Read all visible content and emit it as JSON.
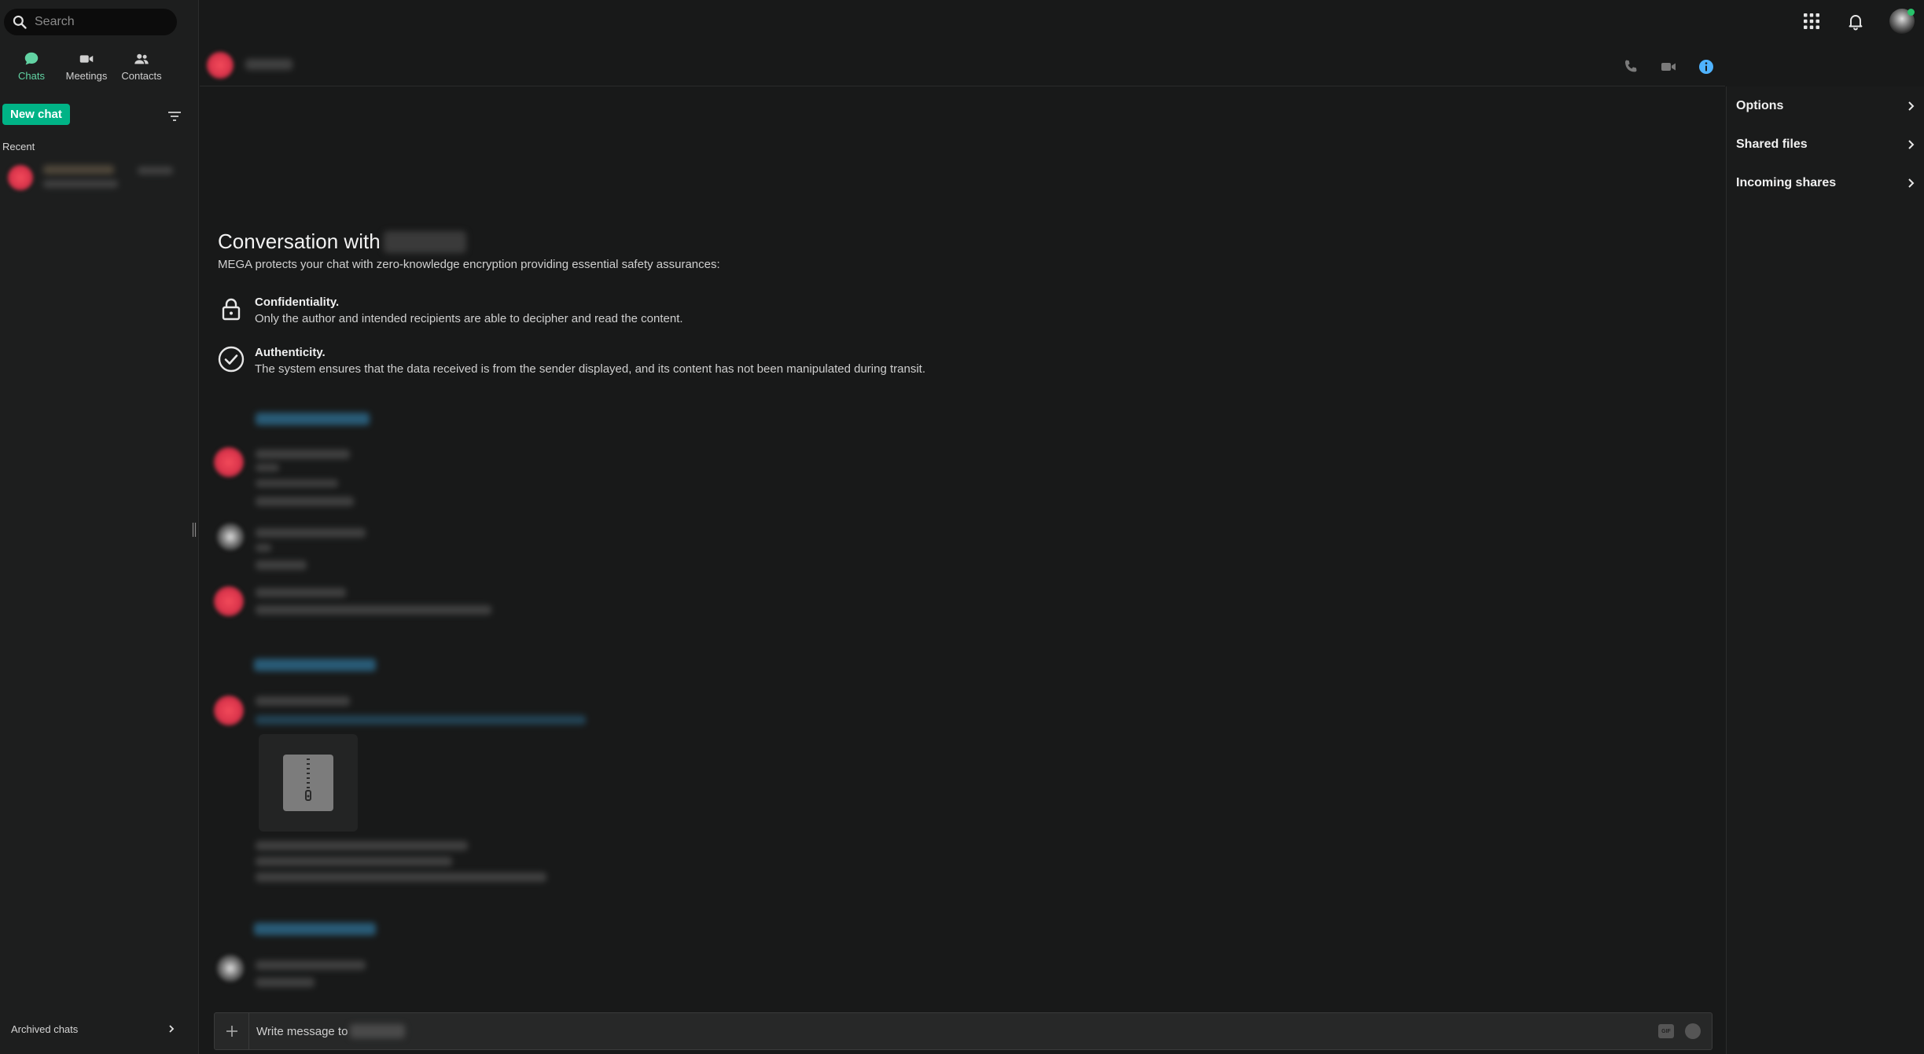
{
  "search": {
    "placeholder": "Search"
  },
  "nav": [
    {
      "label": "Chats",
      "icon": "chat-bubble-icon",
      "active": true
    },
    {
      "label": "Meetings",
      "icon": "video-camera-icon",
      "active": false
    },
    {
      "label": "Contacts",
      "icon": "contacts-icon",
      "active": false
    }
  ],
  "sidebar": {
    "new_chat_label": "New chat",
    "recent_label": "Recent",
    "archived_label": "Archived chats"
  },
  "conversation": {
    "title_prefix": "Conversation with",
    "description": "MEGA protects your chat with zero-knowledge encryption providing essential safety assurances:",
    "features": [
      {
        "title": "Confidentiality.",
        "text": "Only the author and intended recipients are able to decipher and read the content.",
        "icon": "lock-icon"
      },
      {
        "title": "Authenticity.",
        "text": "The system ensures that the data received is from the sender displayed, and its content has not been manipulated during transit.",
        "icon": "check-circle-icon"
      }
    ]
  },
  "composer": {
    "placeholder": "Write message to",
    "gif_label": "GIF"
  },
  "right_panel": {
    "items": [
      {
        "label": "Options"
      },
      {
        "label": "Shared files"
      },
      {
        "label": "Incoming shares"
      }
    ]
  },
  "colors": {
    "accent": "#00b386",
    "active_nav": "#62d3a3",
    "info": "#4fb3ff",
    "background": "#181919"
  }
}
